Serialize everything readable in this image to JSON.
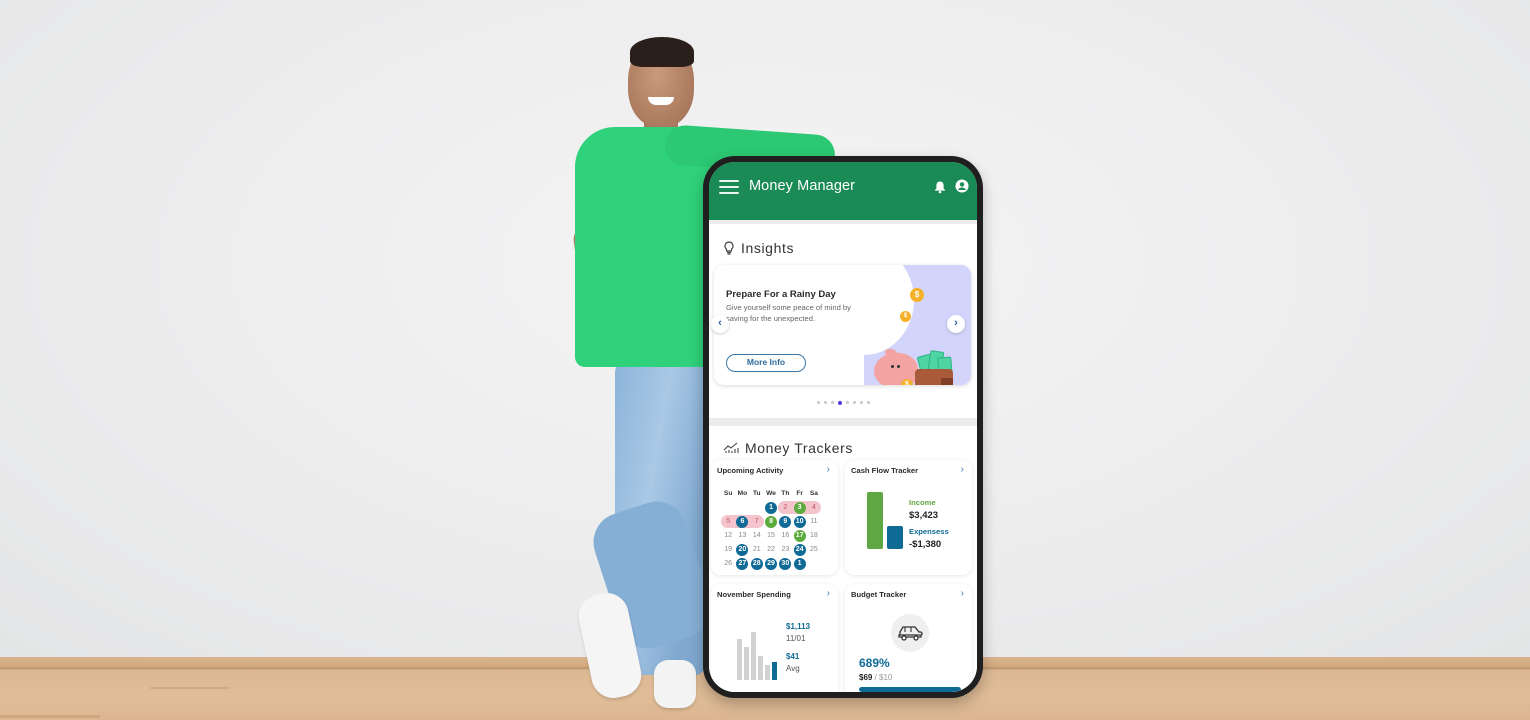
{
  "app": {
    "title": "Money Manager",
    "brand_color": "#1a8a57"
  },
  "insights": {
    "heading": "Insights",
    "card": {
      "title": "Prepare For a Rainy Day",
      "text": "Give yourself some peace of mind by saving for the unexpected.",
      "button_label": "More Info",
      "coin_symbol": "$"
    },
    "carousel": {
      "prev_glyph": "‹",
      "next_glyph": "›",
      "page_count": 8,
      "active_page": 4
    }
  },
  "trackers": {
    "heading": "Money Trackers",
    "chevron": "›",
    "upcoming": {
      "title": "Upcoming Activity",
      "weekdays": [
        "Su",
        "Mo",
        "Tu",
        "We",
        "Th",
        "Fr",
        "Sa"
      ],
      "weeks": [
        [
          {
            "d": ""
          },
          {
            "d": ""
          },
          {
            "d": ""
          },
          {
            "d": "1",
            "s": "blue"
          },
          {
            "d": "2",
            "s": "pink-l"
          },
          {
            "d": "3",
            "s": "green-pink"
          },
          {
            "d": "4",
            "s": "pink-r"
          }
        ],
        [
          {
            "d": "5",
            "s": "pink-l"
          },
          {
            "d": "6",
            "s": "blue-pink"
          },
          {
            "d": "7",
            "s": "pink-r"
          },
          {
            "d": "8",
            "s": "green"
          },
          {
            "d": "9",
            "s": "blue"
          },
          {
            "d": "10",
            "s": "blue"
          },
          {
            "d": "11"
          }
        ],
        [
          {
            "d": "12"
          },
          {
            "d": "13"
          },
          {
            "d": "14"
          },
          {
            "d": "15"
          },
          {
            "d": "16"
          },
          {
            "d": "17",
            "s": "green"
          },
          {
            "d": "18"
          }
        ],
        [
          {
            "d": "19"
          },
          {
            "d": "20",
            "s": "blue"
          },
          {
            "d": "21"
          },
          {
            "d": "22"
          },
          {
            "d": "23"
          },
          {
            "d": "24",
            "s": "blue"
          },
          {
            "d": "25"
          }
        ],
        [
          {
            "d": "26"
          },
          {
            "d": "27",
            "s": "blue"
          },
          {
            "d": "28",
            "s": "blue"
          },
          {
            "d": "29",
            "s": "blue"
          },
          {
            "d": "30",
            "s": "blue"
          },
          {
            "d": "1",
            "s": "blue"
          },
          {
            "d": ""
          }
        ]
      ]
    },
    "cashflow": {
      "title": "Cash Flow Tracker",
      "income_label": "Income",
      "income_value": "$3,423",
      "income_amount": 3423,
      "expenses_label": "Expensess",
      "expenses_value": "-$1,380",
      "expenses_amount": 1380,
      "income_color": "#5fa742",
      "expenses_color": "#0f6a95"
    },
    "spending": {
      "title": "November Spending",
      "peak_value": "$1,113",
      "peak_date": "11/01",
      "avg_value": "$41",
      "avg_label": "Avg",
      "bars_relative": [
        0.78,
        0.64,
        0.92,
        0.46,
        0.28,
        0.34
      ]
    },
    "budget": {
      "title": "Budget Tracker",
      "category_icon": "car-icon",
      "percent": "689%",
      "spent": "$69",
      "separator": " / ",
      "limit": "$10",
      "progress_fraction": 1.0
    }
  }
}
